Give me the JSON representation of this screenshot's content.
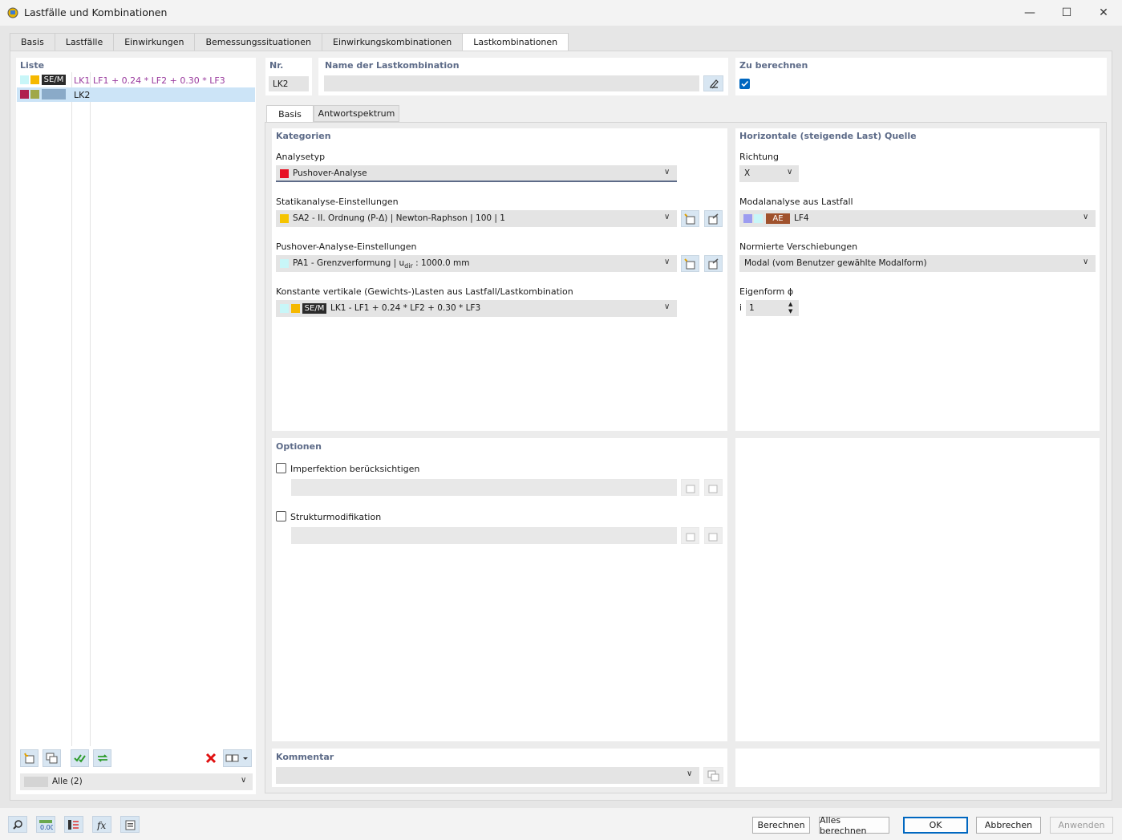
{
  "window": {
    "title": "Lastfälle und Kombinationen"
  },
  "tabs": [
    "Basis",
    "Lastfälle",
    "Einwirkungen",
    "Bemessungssituationen",
    "Einwirkungskombinationen",
    "Lastkombinationen"
  ],
  "list": {
    "header": "Liste",
    "rows": [
      {
        "tag": "SE/M",
        "id": "LK1",
        "formula": "LF1 + 0.24 * LF2 + 0.30 * LF3"
      },
      {
        "tag": "",
        "id": "LK2",
        "formula": ""
      }
    ],
    "filter": "Alle (2)"
  },
  "nr": {
    "label": "Nr.",
    "value": "LK2"
  },
  "name": {
    "label": "Name der Lastkombination",
    "value": ""
  },
  "calc": {
    "label": "Zu berechnen",
    "checked": true
  },
  "subtabs": [
    "Basis",
    "Antwortspektrum"
  ],
  "kategorien": {
    "header": "Kategorien",
    "analysetyp_label": "Analysetyp",
    "analysetyp_value": "Pushover-Analyse",
    "static_label": "Statikanalyse-Einstellungen",
    "static_value": "SA2 - II. Ordnung (P-Δ) | Newton-Raphson | 100 | 1",
    "pushover_label": "Pushover-Analyse-Einstellungen",
    "pushover_value_a": "PA1 - Grenzverformung | u",
    "pushover_value_sub": "dir",
    "pushover_value_b": " : 1000.0 mm",
    "const_label": "Konstante vertikale (Gewichts-)Lasten aus Lastfall/Lastkombination",
    "const_tag": "SE/M",
    "const_value": "LK1 - LF1 + 0.24 * LF2 + 0.30 * LF3"
  },
  "horizontal": {
    "header": "Horizontale (steigende Last) Quelle",
    "richtung_label": "Richtung",
    "richtung_value": "X",
    "modal_label": "Modalanalyse aus Lastfall",
    "modal_tag": "AE",
    "modal_value": "LF4",
    "norm_label": "Normierte Verschiebungen",
    "norm_value": "Modal (vom Benutzer gewählte Modalform)",
    "eigen_label": "Eigenform ɸ",
    "eigen_prefix": "i",
    "eigen_value": "1"
  },
  "optionen": {
    "header": "Optionen",
    "imperfektion": "Imperfektion berücksichtigen",
    "struktur": "Strukturmodifikation"
  },
  "kommentar": {
    "label": "Kommentar",
    "value": ""
  },
  "buttons": {
    "berechnen": "Berechnen",
    "alles": "Alles berechnen",
    "ok": "OK",
    "abbrechen": "Abbrechen",
    "anwenden": "Anwenden"
  },
  "colors": {
    "header": "#5d6b88",
    "accent": "#0067c0",
    "pushover_red": "#e81123",
    "lk_purple": "#9a3b9e"
  }
}
